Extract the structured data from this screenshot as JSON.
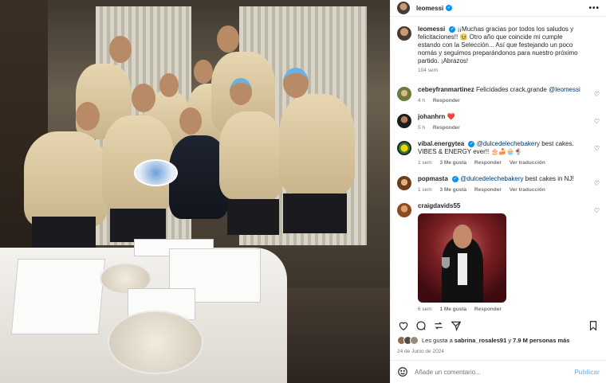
{
  "post": {
    "username": "leomessi",
    "more_label": "•••",
    "caption": {
      "text": "¡¡Muchas gracias por todos los saludos y felicitaciones!! 🥹 Otro año que coincide mi cumple estando con la Selección... Así que festejando un poco nomás y seguimos preparándonos para nuestro próximo partido. ¡Abrazos!",
      "time": "104 sem"
    },
    "comments": [
      {
        "user": "cebeyfranmartinez",
        "verified": false,
        "text": "Felicidades crack,grande ",
        "mention": "@leomessi",
        "time": "4 h",
        "likes": "",
        "reply": "Responder",
        "translate": ""
      },
      {
        "user": "johanhrn",
        "verified": false,
        "text": "❤️",
        "mention": "",
        "time": "5 h",
        "likes": "",
        "reply": "Responder",
        "translate": ""
      },
      {
        "user": "vibal.energytea",
        "verified": true,
        "mention": "@dulcedelechebakery",
        "text": " best cakes. VIBES & ENERGY ever!! 🎂🍰🧁🍨",
        "time": "1 sem",
        "likes": "3 Me gusta",
        "reply": "Responder",
        "translate": "Ver traducción"
      },
      {
        "user": "popmasta",
        "verified": true,
        "mention": "@dulcedelechebakery",
        "text": " best cakes in NJ!",
        "time": "1 sem",
        "likes": "3 Me gusta",
        "reply": "Responder",
        "translate": "Ver traducción"
      },
      {
        "user": "craigdavids55",
        "verified": false,
        "mention": "",
        "text": "",
        "time": "6 sem",
        "likes": "1 Me gusta",
        "reply": "Responder",
        "translate": ""
      }
    ],
    "likes_text_prefix": "Les gusta a ",
    "likes_user": "sabrina_rosales91",
    "likes_text_mid": " y ",
    "likes_count": "7.9 M personas más",
    "date": "24 de Junio de 2024",
    "comment_placeholder": "Añade un comentario...",
    "publish_label": "Publicar"
  },
  "colors": {
    "accent": "#0095f6",
    "link": "#00376b",
    "muted": "#737373",
    "publish": "#84c3f5"
  },
  "icons": {
    "heart": "heart-icon",
    "comment": "comment-icon",
    "share": "share-icon",
    "send": "send-icon",
    "save": "bookmark-icon",
    "emoji": "emoji-icon"
  }
}
